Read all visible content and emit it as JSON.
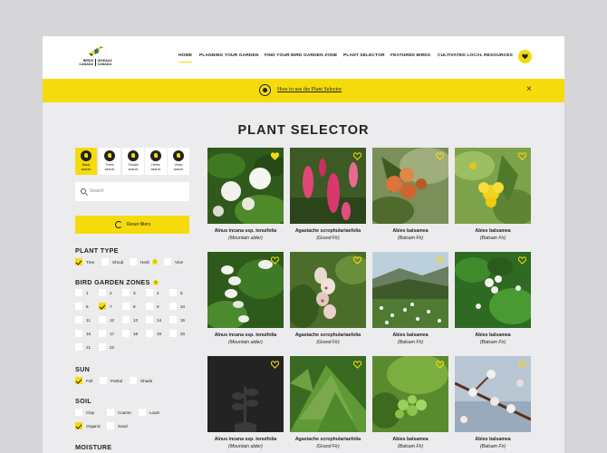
{
  "brand": {
    "name_en": "BIRDS CANADA",
    "name_fr": "OISEAUX CANADA"
  },
  "nav": [
    "HOME",
    "PLANNING YOUR GARDEN",
    "FIND YOUR BIRD GARDEN ZONE",
    "PLANT SELECTOR",
    "FEATURED BIRDS",
    "CULTIVATED LOCAL RESOURCES"
  ],
  "banner": {
    "text": "How to use the Plant Selector",
    "close": "×"
  },
  "page_title": "PLANT SELECTOR",
  "plant_types": [
    {
      "label1": "Basic",
      "label2": "search",
      "active": true
    },
    {
      "label1": "Trees",
      "label2": "search",
      "active": false
    },
    {
      "label1": "Shrubs",
      "label2": "search",
      "active": false
    },
    {
      "label1": "Herbs",
      "label2": "search",
      "active": false
    },
    {
      "label1": "Vines",
      "label2": "search",
      "active": false
    }
  ],
  "search": {
    "placeholder": "Search"
  },
  "reset_label": "Reset filters",
  "filters": {
    "plant_type": {
      "title": "PLANT TYPE",
      "options": [
        {
          "label": "Tree",
          "checked": true
        },
        {
          "label": "Shrub",
          "checked": false
        },
        {
          "label": "Herb",
          "checked": false,
          "help": "?"
        },
        {
          "label": "Vine",
          "checked": false
        }
      ]
    },
    "zones": {
      "title": "BIRD GARDEN ZONES",
      "help": "?",
      "options": [
        {
          "label": "1",
          "checked": false
        },
        {
          "label": "2",
          "checked": false
        },
        {
          "label": "3",
          "checked": false
        },
        {
          "label": "4",
          "checked": false
        },
        {
          "label": "5",
          "checked": false
        },
        {
          "label": "6",
          "checked": false
        },
        {
          "label": "7",
          "checked": true
        },
        {
          "label": "8",
          "checked": false
        },
        {
          "label": "9",
          "checked": false
        },
        {
          "label": "10",
          "checked": false
        },
        {
          "label": "11",
          "checked": false
        },
        {
          "label": "12",
          "checked": false
        },
        {
          "label": "13",
          "checked": false
        },
        {
          "label": "14",
          "checked": false
        },
        {
          "label": "15",
          "checked": false
        },
        {
          "label": "16",
          "checked": false
        },
        {
          "label": "17",
          "checked": false
        },
        {
          "label": "18",
          "checked": false
        },
        {
          "label": "19",
          "checked": false
        },
        {
          "label": "20",
          "checked": false
        },
        {
          "label": "21",
          "checked": false
        },
        {
          "label": "22",
          "checked": false
        }
      ]
    },
    "sun": {
      "title": "SUN",
      "options": [
        {
          "label": "Full",
          "checked": true
        },
        {
          "label": "Partial",
          "checked": false
        },
        {
          "label": "Shade",
          "checked": false
        }
      ]
    },
    "soil": {
      "title": "SOIL",
      "options": [
        {
          "label": "Clay",
          "checked": false
        },
        {
          "label": "Coarse",
          "checked": false
        },
        {
          "label": "Loam",
          "checked": false
        },
        {
          "label": "Organic",
          "checked": true
        },
        {
          "label": "Sand",
          "checked": false
        }
      ]
    },
    "moisture": {
      "title": "MOISTURE"
    }
  },
  "plants": [
    {
      "name": "Alnus incana ssp. tenuifolia",
      "common": "(Mountain alder)",
      "favorited": true,
      "icon": "white-flower-clusters"
    },
    {
      "name": "Agastache scrophulariaefolia",
      "common": "(Grand Fir)",
      "favorited": false,
      "icon": "pink-flower-spikes"
    },
    {
      "name": "Abies balsamea",
      "common": "(Balsam Fir)",
      "favorited": false,
      "icon": "orange-berries"
    },
    {
      "name": "Abies balsamea",
      "common": "(Balsam Fir)",
      "favorited": false,
      "icon": "yellow-flower"
    },
    {
      "name": "Alnus incana ssp. tenuifolia",
      "common": "(Mountain alder)",
      "favorited": false,
      "icon": "white-bell-flowers"
    },
    {
      "name": "Agastache scrophulariaefolia",
      "common": "(Grand Fir)",
      "favorited": false,
      "icon": "pink-speckled-flowers"
    },
    {
      "name": "Abies balsamea",
      "common": "(Balsam Fir)",
      "favorited": false,
      "icon": "meadow-landscape"
    },
    {
      "name": "Abies balsamea",
      "common": "(Balsam Fir)",
      "favorited": false,
      "icon": "white-flowers-leaves"
    },
    {
      "name": "Alnus incana ssp. tenuifolia",
      "common": "(Mountain alder)",
      "favorited": false,
      "icon": "plant-placeholder"
    },
    {
      "name": "Agastache scrophulariaefolia",
      "common": "(Grand Fir)",
      "favorited": false,
      "icon": "cedar-foliage"
    },
    {
      "name": "Abies balsamea",
      "common": "(Balsam Fir)",
      "favorited": false,
      "icon": "green-berries"
    },
    {
      "name": "Abies balsamea",
      "common": "(Balsam Fir)",
      "favorited": false,
      "icon": "white-blossom-branch"
    }
  ],
  "colors": {
    "accent": "#f5db0b",
    "text": "#222222",
    "background": "#ececee",
    "tile_dark": "#232323"
  }
}
